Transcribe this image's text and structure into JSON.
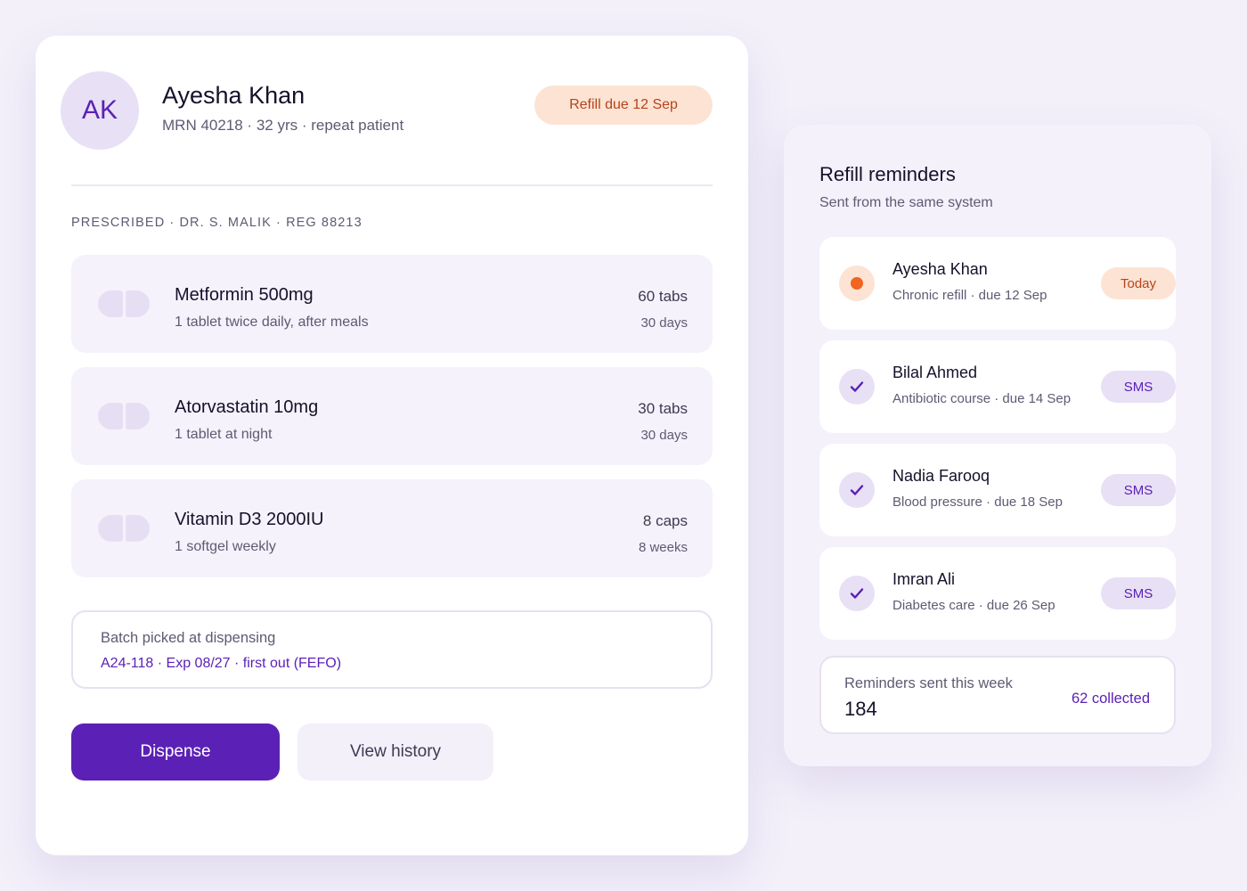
{
  "patient": {
    "initials": "AK",
    "name": "Ayesha Khan",
    "meta": "MRN 40218 · 32 yrs · repeat patient",
    "refill_badge": "Refill due 12 Sep"
  },
  "prescription": {
    "label": "PRESCRIBED · DR. S. MALIK · REG 88213",
    "medications": [
      {
        "name": "Metformin 500mg",
        "dose": "1 tablet twice daily, after meals",
        "quantity": "60 tabs",
        "duration": "30 days",
        "icon": "pill-icon"
      },
      {
        "name": "Atorvastatin 10mg",
        "dose": "1 tablet at night",
        "quantity": "30 tabs",
        "duration": "30 days",
        "icon": "pill-icon"
      },
      {
        "name": "Vitamin D3 2000IU",
        "dose": "1 softgel weekly",
        "quantity": "8 caps",
        "duration": "8 weeks",
        "icon": "pill-icon"
      }
    ]
  },
  "batch": {
    "label": "Batch picked at dispensing",
    "value": "A24-118 · Exp 08/27 · first out (FEFO)"
  },
  "actions": {
    "dispense_label": "Dispense",
    "history_label": "View history"
  },
  "reminders": {
    "title": "Refill reminders",
    "subtitle": "Sent from the same system",
    "items": [
      {
        "name": "Ayesha Khan",
        "detail": "Chronic refill · due 12 Sep",
        "tag": "Today",
        "status": "pending"
      },
      {
        "name": "Bilal Ahmed",
        "detail": "Antibiotic course · due 14 Sep",
        "tag": "SMS",
        "status": "sent"
      },
      {
        "name": "Nadia Farooq",
        "detail": "Blood pressure · due 18 Sep",
        "tag": "SMS",
        "status": "sent"
      },
      {
        "name": "Imran Ali",
        "detail": "Diabetes care · due 26 Sep",
        "tag": "SMS",
        "status": "sent"
      }
    ],
    "stats": {
      "label": "Reminders sent this week",
      "value": "184",
      "collected": "62 collected"
    }
  },
  "colors": {
    "accent": "#5b21b6",
    "warning": "#f2641f",
    "warning_bg": "#fde3d3",
    "accent_bg": "#e8e0f5",
    "page_bg": "#f3f0fa"
  }
}
